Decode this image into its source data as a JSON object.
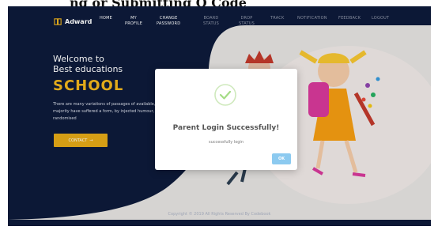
{
  "top_strip_text": "ng or Submitting Q Code",
  "brand": {
    "name": "Adward"
  },
  "nav": [
    {
      "label": "HOME"
    },
    {
      "label": "MY\nPROFILE"
    },
    {
      "label": "CHANGE\nPASSWORD"
    },
    {
      "label": "BOARD\nSTATUS"
    },
    {
      "label": "DROP\nSTATUS"
    },
    {
      "label": "TRACK"
    },
    {
      "label": "NOTIFICATION"
    },
    {
      "label": "FEEDBACK"
    },
    {
      "label": "LOGOUT"
    }
  ],
  "hero": {
    "welcome_line1": "Welcome to",
    "welcome_line2": "Best educations",
    "school": "SCHOOL",
    "paragraph": "There are many variations of passages of available, but the majority have suffered a form, by injected humour, or randomised",
    "contact_label": "CONTACT",
    "contact_arrow": "→"
  },
  "footer": {
    "copyright": "Copyright © 2019 All Rights Reserved By Codebook"
  },
  "modal": {
    "title": "Parent Login Successfully!",
    "text": "successfully login",
    "ok_label": "OK"
  },
  "colors": {
    "navy": "#0d1a3a",
    "accent": "#f1b51c",
    "success": "#a5dc86",
    "ok_button": "#8ccaf0"
  },
  "icons": [
    "book-icon",
    "success-check-icon",
    "arrow-right-icon"
  ]
}
